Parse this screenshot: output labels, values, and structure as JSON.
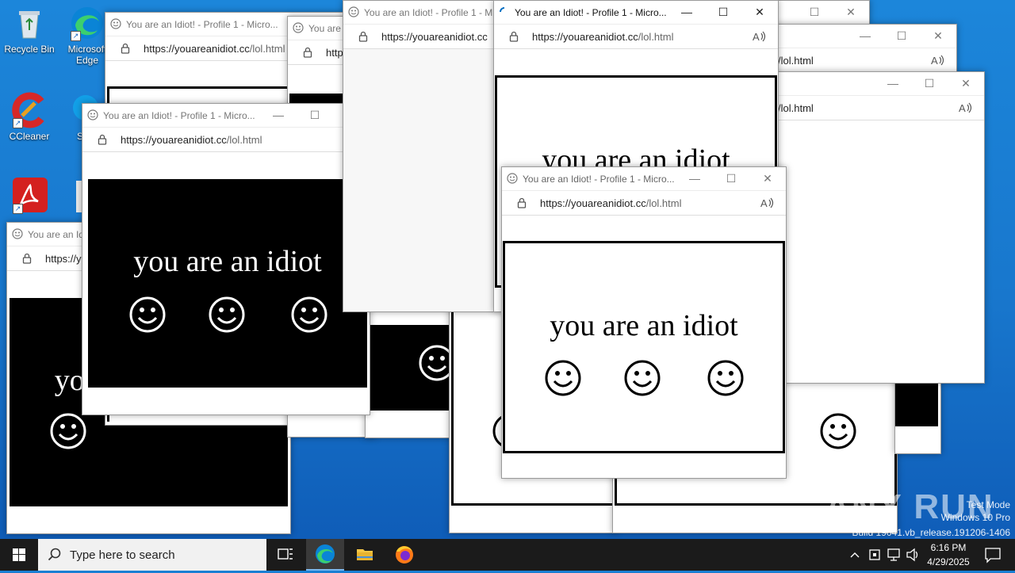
{
  "desktop": {
    "icons": [
      {
        "label": "Recycle Bin"
      },
      {
        "label": "Microsoft Edge"
      },
      {
        "label": "CCleaner"
      },
      {
        "label": "Sk"
      },
      {
        "label": "Acrobat"
      }
    ]
  },
  "browser": {
    "window_title": "You are an Idiot! - Profile 1 - Micro...",
    "url_host": "https://youareanidiot.cc",
    "url_path": "/lol.html",
    "page_text": "you are an idiot"
  },
  "taskbar": {
    "search_placeholder": "Type here to search",
    "time": "6:16 PM",
    "date": "4/29/2025"
  },
  "watermark": {
    "test_mode": "Test Mode",
    "edition": "Windows 10 Pro",
    "build": "Build 19041.vb_release.191206-1406",
    "brand": "ANY RUN"
  },
  "colors": {
    "desktop_blue": "#1a7fd3",
    "taskbar": "#1b1b1b",
    "edge_blue": "#0a84d6"
  }
}
